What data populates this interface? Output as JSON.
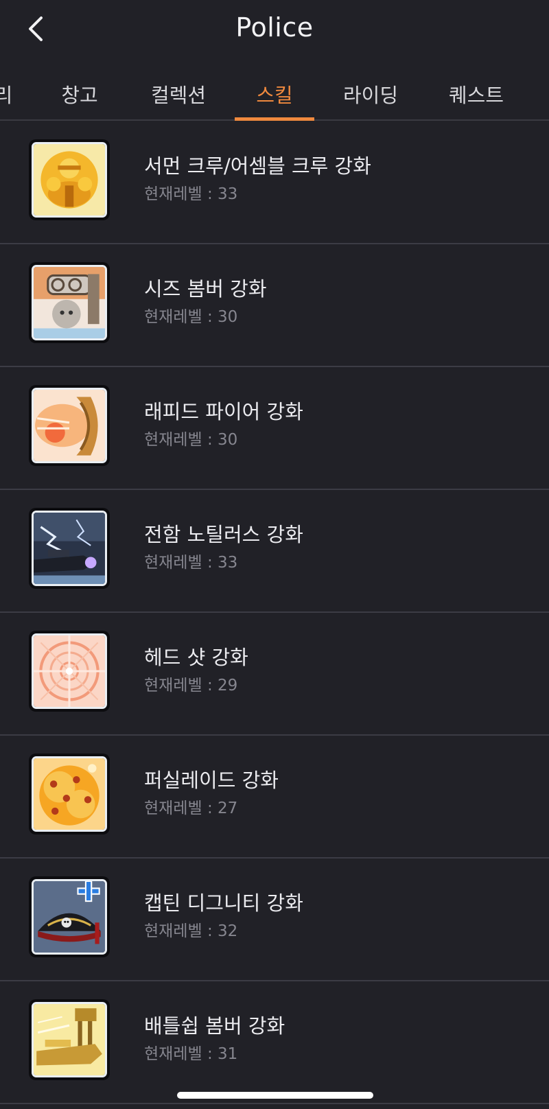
{
  "header": {
    "title": "Police",
    "back_icon": "chevron-left-icon"
  },
  "tabs": [
    {
      "label": "리",
      "active": false
    },
    {
      "label": "창고",
      "active": false
    },
    {
      "label": "컬렉션",
      "active": false
    },
    {
      "label": "스킬",
      "active": true
    },
    {
      "label": "라이딩",
      "active": false
    },
    {
      "label": "퀘스트",
      "active": false
    }
  ],
  "colors": {
    "accent": "#f0893e",
    "background": "#212127"
  },
  "skills": [
    {
      "name": "서먼 크루/어셈블 크루 강화",
      "level_text": "현재레벨 : 33",
      "icon": "summon-crew-icon"
    },
    {
      "name": "시즈 봄버 강화",
      "level_text": "현재레벨 : 30",
      "icon": "siege-bomber-icon"
    },
    {
      "name": "래피드 파이어 강화",
      "level_text": "현재레벨 : 30",
      "icon": "rapid-fire-icon"
    },
    {
      "name": "전함 노틸러스 강화",
      "level_text": "현재레벨 : 33",
      "icon": "battleship-nautilus-icon"
    },
    {
      "name": "헤드 샷 강화",
      "level_text": "현재레벨 : 29",
      "icon": "headshot-icon"
    },
    {
      "name": "퍼실레이드 강화",
      "level_text": "현재레벨 : 27",
      "icon": "fusillade-icon"
    },
    {
      "name": "캡틴 디그니티 강화",
      "level_text": "현재레벨 : 32",
      "icon": "captain-dignity-icon"
    },
    {
      "name": "배틀쉽 봄버 강화",
      "level_text": "현재레벨 : 31",
      "icon": "battleship-bomber-icon"
    }
  ]
}
